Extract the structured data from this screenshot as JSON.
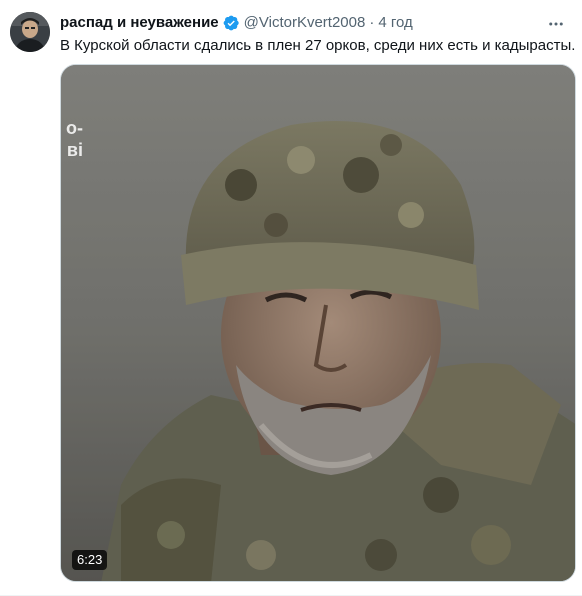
{
  "tweet": {
    "author": {
      "display_name": "распад и неуважение",
      "handle": "@VictorKvert2008",
      "verified": true,
      "avatar_icon": "avatar-photo"
    },
    "separator": "·",
    "time": "4 год",
    "text": "В Курской области сдались в плен 27 орков, среди них есть и кадырасты.",
    "more_icon": "more-options-icon",
    "media": {
      "type": "video",
      "duration": "6:23",
      "overlay_text_lines": [
        "о-",
        "ві"
      ]
    }
  },
  "colors": {
    "text_primary": "#0f1419",
    "text_secondary": "#536471",
    "verified_blue": "#1d9bf0",
    "border": "#cfd9de"
  }
}
